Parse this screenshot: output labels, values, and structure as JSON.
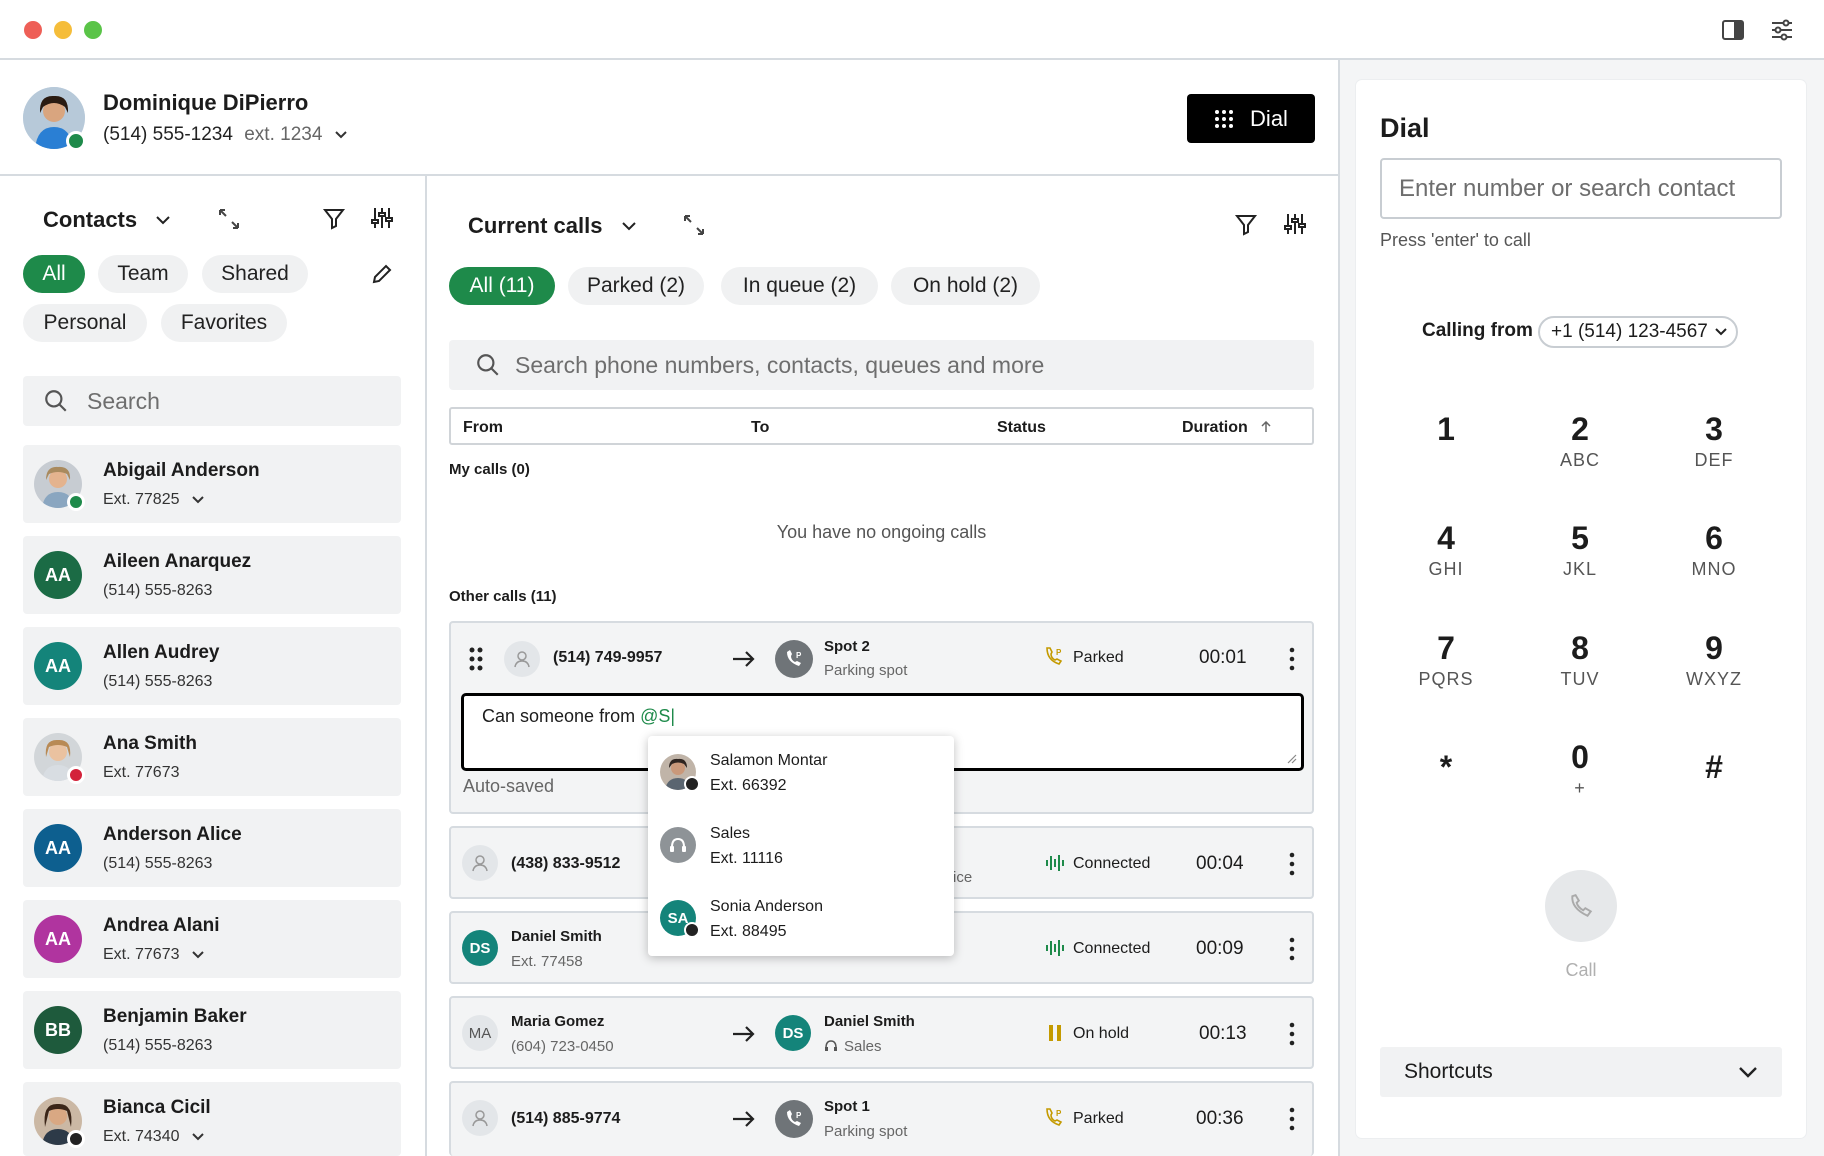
{
  "header": {
    "user_name": "Dominique DiPierro",
    "phone": "(514) 555-1234",
    "ext": "ext. 1234",
    "dial_label": "Dial"
  },
  "contacts": {
    "title": "Contacts",
    "filters": [
      "All",
      "Team",
      "Shared",
      "Personal",
      "Favorites"
    ],
    "search_placeholder": "Search",
    "items": [
      {
        "name": "Abigail Anderson",
        "sub": "Ext. 77825",
        "avatar": "photo",
        "status": "online",
        "dropdown": true
      },
      {
        "name": "Aileen Anarquez",
        "sub": "(514) 555-8263",
        "initials": "AA",
        "color": "#1b6b45"
      },
      {
        "name": "Allen Audrey",
        "sub": "(514) 555-8263",
        "initials": "AA",
        "color": "#14847a"
      },
      {
        "name": "Ana Smith",
        "sub": "Ext. 77673",
        "avatar": "photo",
        "status": "busy"
      },
      {
        "name": "Anderson Alice",
        "sub": "(514) 555-8263",
        "initials": "AA",
        "color": "#0d5f8f"
      },
      {
        "name": "Andrea Alani",
        "sub": "Ext. 77673",
        "initials": "AA",
        "color": "#b0349f",
        "dropdown": true
      },
      {
        "name": "Benjamin Baker",
        "sub": "(514) 555-8263",
        "initials": "BB",
        "color": "#1e5a3c"
      },
      {
        "name": "Bianca Cicil",
        "sub": "Ext. 74340",
        "avatar": "photo",
        "status": "away",
        "dropdown": true
      }
    ]
  },
  "calls": {
    "title": "Current calls",
    "tabs": [
      "All (11)",
      "Parked (2)",
      "In queue (2)",
      "On hold (2)"
    ],
    "search_placeholder": "Search phone numbers, contacts, queues and more",
    "columns": {
      "from": "From",
      "to": "To",
      "status": "Status",
      "duration": "Duration"
    },
    "my_calls_label": "My calls (0)",
    "empty_text": "You have no ongoing calls",
    "other_calls_label": "Other calls (11)",
    "note_text_prefix": "Can someone from ",
    "note_mention": "@S|",
    "autosaved": "Auto-saved",
    "rows": [
      {
        "from": "(514) 749-9957",
        "to_name": "Spot 2",
        "to_sub": "Parking spot",
        "status": "Parked",
        "duration": "00:01"
      },
      {
        "from": "(438) 833-9512",
        "to_sub_partial": "ice",
        "status": "Connected",
        "duration": "00:04"
      },
      {
        "from": "Daniel Smith",
        "from_sub": "Ext. 77458",
        "from_initials": "DS",
        "status": "Connected",
        "duration": "00:09"
      },
      {
        "from": "Maria Gomez",
        "from_sub": "(604) 723-0450",
        "from_initials": "MA",
        "to_initials": "DS",
        "to_name": "Daniel Smith",
        "to_sub": "Sales",
        "status": "On hold",
        "duration": "00:13"
      },
      {
        "from": "(514) 885-9774",
        "to_name": "Spot 1",
        "to_sub": "Parking spot",
        "status": "Parked",
        "duration": "00:36"
      }
    ],
    "mention_suggestions": [
      {
        "name": "Salamon Montar",
        "ext": "Ext. 66392"
      },
      {
        "name": "Sales",
        "ext": "Ext. 11116"
      },
      {
        "name": "Sonia Anderson",
        "ext": "Ext. 88495",
        "initials": "SA"
      }
    ]
  },
  "dial": {
    "title": "Dial",
    "input_placeholder": "Enter number or search contact",
    "hint": "Press 'enter' to call",
    "calling_from_label": "Calling from",
    "calling_from_number": "+1 (514) 123-4567",
    "keys": [
      {
        "d": "1",
        "l": ""
      },
      {
        "d": "2",
        "l": "ABC"
      },
      {
        "d": "3",
        "l": "DEF"
      },
      {
        "d": "4",
        "l": "GHI"
      },
      {
        "d": "5",
        "l": "JKL"
      },
      {
        "d": "6",
        "l": "MNO"
      },
      {
        "d": "7",
        "l": "PQRS"
      },
      {
        "d": "8",
        "l": "TUV"
      },
      {
        "d": "9",
        "l": "WXYZ"
      },
      {
        "d": "*",
        "l": ""
      },
      {
        "d": "0",
        "l": "+"
      },
      {
        "d": "#",
        "l": ""
      }
    ],
    "call_label": "Call",
    "shortcuts_label": "Shortcuts"
  },
  "colors": {
    "accent": "#1e8a4a",
    "parked": "#c49a00",
    "connected": "#1e8a4a",
    "hold": "#c49a00"
  }
}
